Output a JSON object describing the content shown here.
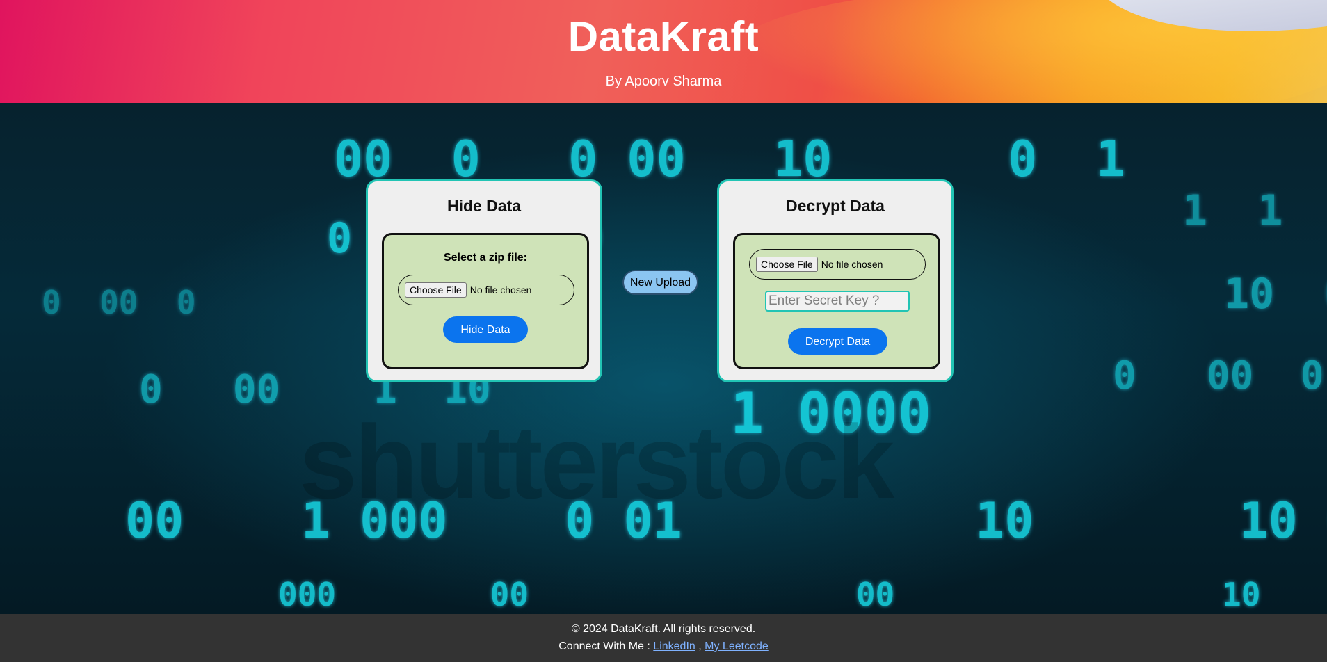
{
  "header": {
    "title": "DataKraft",
    "subtitle": "By Apoorv Sharma"
  },
  "background": {
    "watermark": "shutterstock"
  },
  "hide_card": {
    "title": "Hide Data",
    "file_label": "Select a zip file:",
    "choose_file_label": "Choose File",
    "no_file_text": "No file chosen",
    "submit_label": "Hide Data"
  },
  "new_upload_label": "New Upload",
  "decrypt_card": {
    "title": "Decrypt Data",
    "choose_file_label": "Choose File",
    "no_file_text": "No file chosen",
    "secret_key_placeholder": "Enter Secret Key ?",
    "secret_key_value": "",
    "submit_label": "Decrypt Data"
  },
  "footer": {
    "copyright": "© 2024 DataKraft. All rights reserved.",
    "connect_prefix": "Connect With Me :",
    "separator": ",",
    "linkedin_label": "LinkedIn",
    "leetcode_label": "My Leetcode"
  },
  "colors": {
    "accent_button": "#0b74ee",
    "card_border": "#22c4b4",
    "inner_panel": "#cfe3b8",
    "footer_bg": "#333333",
    "new_upload_bg": "#8bc5f1"
  }
}
